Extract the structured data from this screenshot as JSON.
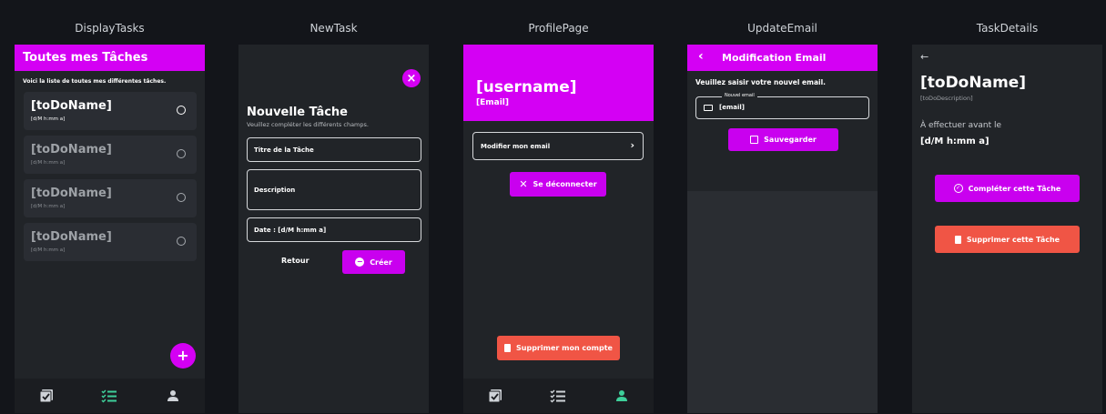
{
  "columns": [
    "DisplayTasks",
    "NewTask",
    "ProfilePage",
    "UpdateEmail",
    "TaskDetails"
  ],
  "display_tasks": {
    "header_title": "Toutes mes Tâches",
    "subtitle": "Voici la liste de toutes mes différentes tâches.",
    "tasks": [
      {
        "name": "[toDoName]",
        "date": "[d/M h:mm a]"
      },
      {
        "name": "[toDoName]",
        "date": "[d/M h:mm a]"
      },
      {
        "name": "[toDoName]",
        "date": "[d/M h:mm a]"
      },
      {
        "name": "[toDoName]",
        "date": "[d/M h:mm a]"
      }
    ],
    "fab_label": "+"
  },
  "new_task": {
    "close_label": "×",
    "title": "Nouvelle Tâche",
    "subtitle": "Veuillez compléter les différents champs.",
    "title_field_placeholder": "Titre de la Tâche",
    "description_placeholder": "Description",
    "date_field": "Date : [d/M h:mm a]",
    "back_label": "Retour",
    "create_label": "Créer"
  },
  "profile": {
    "username": "[username]",
    "email": "[Email]",
    "modify_email_label": "Modifier mon email",
    "logout_label": "Se déconnecter",
    "delete_account_label": "Supprimer mon compte"
  },
  "update_email": {
    "header_title": "Modification Email",
    "instruction": "Veuillez saisir votre nouvel email.",
    "field_label": "Nouvel email",
    "field_value": "[email]",
    "save_label": "Sauvegarder"
  },
  "task_details": {
    "back_arrow": "←",
    "name": "[toDoName]",
    "description": "[toDoDescription]",
    "due_label": "À effectuer avant le",
    "due_value": "[d/M h:mm a]",
    "complete_label": "Compléter cette Tâche",
    "delete_label": "Supprimer cette Tâche"
  },
  "colors": {
    "accent": "#d400f4",
    "danger": "#f05545",
    "nav_active": "#3ecf9a",
    "surface": "#212428",
    "background": "#13151a"
  }
}
